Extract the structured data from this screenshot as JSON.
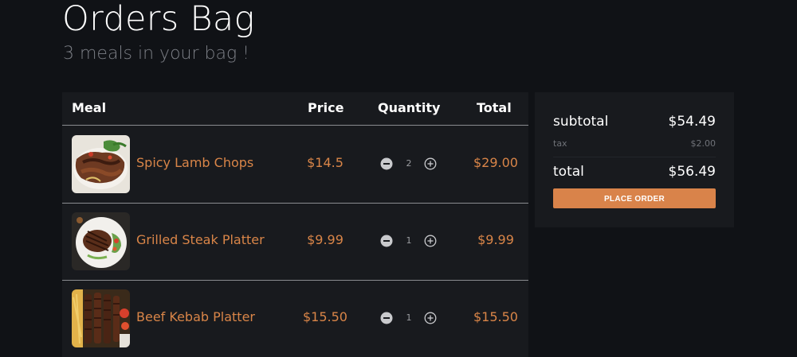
{
  "header": {
    "title": "Orders Bag",
    "subtitle": "3 meals in your bag !"
  },
  "table": {
    "columns": {
      "meal": "Meal",
      "price": "Price",
      "quantity": "Quantity",
      "total": "Total"
    },
    "rows": [
      {
        "name": "Spicy Lamb Chops",
        "price": "$14.5",
        "quantity": "2",
        "total": "$29.00"
      },
      {
        "name": "Grilled Steak Platter",
        "price": "$9.99",
        "quantity": "1",
        "total": "$9.99"
      },
      {
        "name": "Beef Kebab Platter",
        "price": "$15.50",
        "quantity": "1",
        "total": "$15.50"
      }
    ],
    "icons": {
      "decrease": "minus-circle-icon",
      "increase": "plus-circle-icon"
    }
  },
  "summary": {
    "subtotal_label": "subtotal",
    "subtotal_value": "$54.49",
    "tax_label": "tax",
    "tax_value": "$2.00",
    "total_label": "total",
    "total_value": "$56.49",
    "button_label": "PLACE ORDER"
  },
  "colors": {
    "background": "#101216",
    "panel": "#181a1e",
    "accent": "#d98548",
    "button": "#d9834a"
  }
}
